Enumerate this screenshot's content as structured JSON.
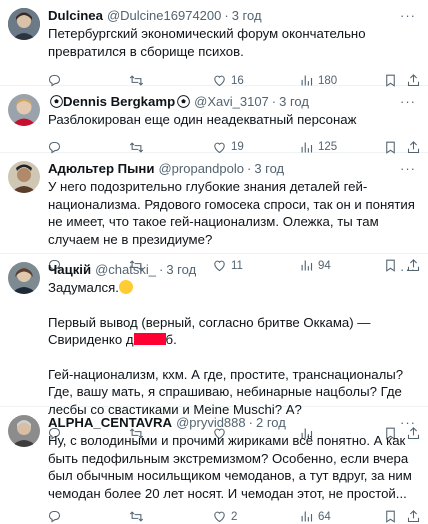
{
  "tweets": [
    {
      "name": "Dulcinea",
      "handle": "@Dulcine16974200",
      "dot": "·",
      "time": "3 год",
      "lines": [
        "Петербургский экономический форум окончательно превратился в сборище психов."
      ],
      "replies": "",
      "retweets": "",
      "likes": "16",
      "views": "180"
    },
    {
      "name": "Dennis Bergkamp",
      "handle": "@Xavi_3107",
      "dot": "·",
      "time": "3 год",
      "lines": [
        "Разблокирован еще один неадекватный персонаж"
      ],
      "replies": "",
      "retweets": "",
      "likes": "19",
      "views": "125"
    },
    {
      "name": "Адюльтер Пыни",
      "handle": "@propandpolo",
      "dot": "·",
      "time": "3 год",
      "lines": [
        "У него подозрительно глубокие знания деталей гей-национализма. Рядового гомосека спроси, так он и понятия не имеет, что такое гей-национализм. Олежка, ты там случаем не в президиуме?"
      ],
      "replies": "",
      "retweets": "",
      "likes": "11",
      "views": "94"
    },
    {
      "name": "Чацкій",
      "handle": "@chatski_",
      "dot": "·",
      "time": "3 год",
      "para1": "Задумался.",
      "para2_a": "Первый вывод (верный, согласно бритве Оккама) — Свириденко д",
      "para2_b": "б.",
      "para3": "Гей-национализм, кхм. А где, простите, транснационалы? Где, вашу мать, я спрашиваю, небинарные нацболы? Где лесбы со свастиками и Meine Muschi? А?",
      "replies": "",
      "retweets": "",
      "likes": "",
      "views": ""
    },
    {
      "name": "ALPHA_CENTAVRA",
      "handle": "@pryvid888",
      "dot": "·",
      "time": "2 год",
      "lines": [
        "Ну, с володиными и прочими жириками всё понятно. А как быть педофильным экстремизмом? Особенно, если вчера был обычным носильщиком чемоданов, а тут вдруг, за ним чемодан более 20 лет носят. И чемодан этот, не простой..."
      ],
      "replies": "",
      "retweets": "",
      "likes": "2",
      "views": "64"
    }
  ],
  "more_label": "···",
  "colors": {
    "text": "#0f1419",
    "muted": "#536471",
    "border": "#eff3f4",
    "redaction": "#ff0033"
  },
  "icons": [
    "reply-icon",
    "retweet-icon",
    "like-icon",
    "views-icon",
    "bookmark-icon",
    "share-icon",
    "more-icon",
    "thinking-emoji",
    "soccer-ball-icon"
  ]
}
